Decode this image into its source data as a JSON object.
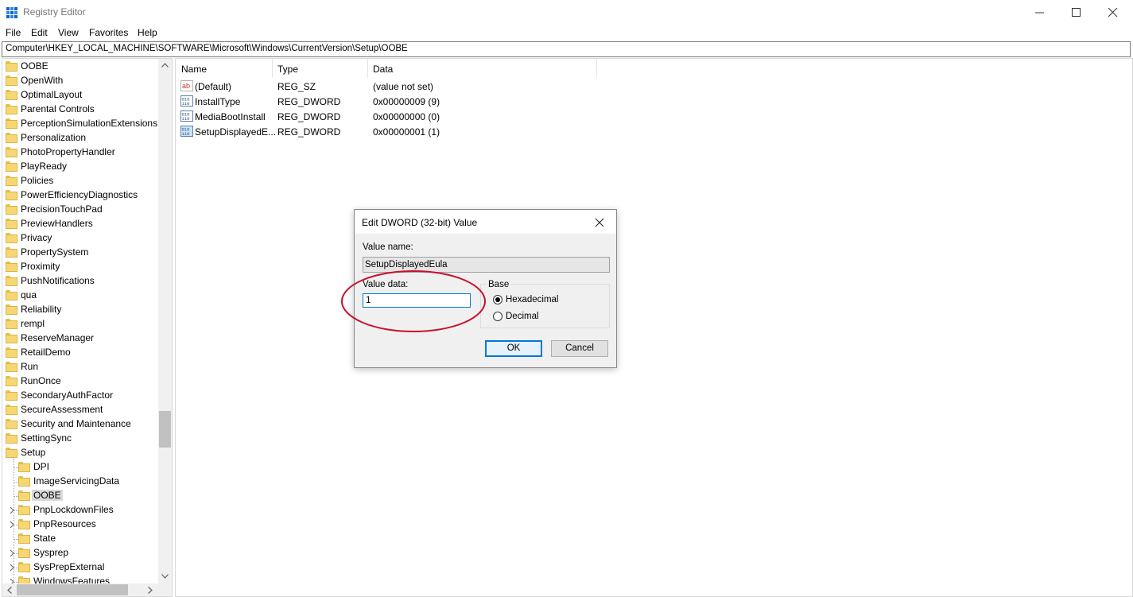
{
  "window": {
    "title": "Registry Editor",
    "icon": "registry-editor-icon"
  },
  "menu": [
    "File",
    "Edit",
    "View",
    "Favorites",
    "Help"
  ],
  "address": "Computer\\HKEY_LOCAL_MACHINE\\SOFTWARE\\Microsoft\\Windows\\CurrentVersion\\Setup\\OOBE",
  "tree": {
    "items": [
      {
        "label": "OOBE",
        "level": 1
      },
      {
        "label": "OpenWith",
        "level": 1
      },
      {
        "label": "OptimalLayout",
        "level": 1
      },
      {
        "label": "Parental Controls",
        "level": 1
      },
      {
        "label": "PerceptionSimulationExtensions",
        "level": 1
      },
      {
        "label": "Personalization",
        "level": 1
      },
      {
        "label": "PhotoPropertyHandler",
        "level": 1
      },
      {
        "label": "PlayReady",
        "level": 1
      },
      {
        "label": "Policies",
        "level": 1
      },
      {
        "label": "PowerEfficiencyDiagnostics",
        "level": 1
      },
      {
        "label": "PrecisionTouchPad",
        "level": 1
      },
      {
        "label": "PreviewHandlers",
        "level": 1
      },
      {
        "label": "Privacy",
        "level": 1
      },
      {
        "label": "PropertySystem",
        "level": 1
      },
      {
        "label": "Proximity",
        "level": 1
      },
      {
        "label": "PushNotifications",
        "level": 1
      },
      {
        "label": "qua",
        "level": 1
      },
      {
        "label": "Reliability",
        "level": 1
      },
      {
        "label": "rempl",
        "level": 1
      },
      {
        "label": "ReserveManager",
        "level": 1
      },
      {
        "label": "RetailDemo",
        "level": 1
      },
      {
        "label": "Run",
        "level": 1
      },
      {
        "label": "RunOnce",
        "level": 1
      },
      {
        "label": "SecondaryAuthFactor",
        "level": 1
      },
      {
        "label": "SecureAssessment",
        "level": 1
      },
      {
        "label": "Security and Maintenance",
        "level": 1
      },
      {
        "label": "SettingSync",
        "level": 1
      },
      {
        "label": "Setup",
        "level": 1
      },
      {
        "label": "DPI",
        "level": 2
      },
      {
        "label": "ImageServicingData",
        "level": 2
      },
      {
        "label": "OOBE",
        "level": 2,
        "selected": true
      },
      {
        "label": "PnpLockdownFiles",
        "level": 2,
        "expandable": true
      },
      {
        "label": "PnpResources",
        "level": 2,
        "expandable": true
      },
      {
        "label": "State",
        "level": 2
      },
      {
        "label": "Sysprep",
        "level": 2,
        "expandable": true
      },
      {
        "label": "SysPrepExternal",
        "level": 2,
        "expandable": true
      },
      {
        "label": "WindowsFeatures",
        "level": 2,
        "expandable": true
      }
    ]
  },
  "list": {
    "columns": [
      "Name",
      "Type",
      "Data"
    ],
    "rows": [
      {
        "name": "(Default)",
        "type": "REG_SZ",
        "data": "(value not set)",
        "icon": "string-value-icon"
      },
      {
        "name": "InstallType",
        "type": "REG_DWORD",
        "data": "0x00000009 (9)",
        "icon": "binary-value-icon"
      },
      {
        "name": "MediaBootInstall",
        "type": "REG_DWORD",
        "data": "0x00000000 (0)",
        "icon": "binary-value-icon"
      },
      {
        "name": "SetupDisplayedE...",
        "type": "REG_DWORD",
        "data": "0x00000001 (1)",
        "icon": "binary-value-icon",
        "selected": true
      }
    ]
  },
  "dialog": {
    "title": "Edit DWORD (32-bit) Value",
    "value_name_label": "Value name:",
    "value_name": "SetupDisplayedEula",
    "value_data_label": "Value data:",
    "value_data": "1",
    "base_label": "Base",
    "base_options": [
      "Hexadecimal",
      "Decimal"
    ],
    "base_selected": "Hexadecimal",
    "ok_label": "OK",
    "cancel_label": "Cancel"
  },
  "colors": {
    "accent": "#0078d7",
    "annotation": "#c8102e",
    "folder": "#f7d774"
  }
}
